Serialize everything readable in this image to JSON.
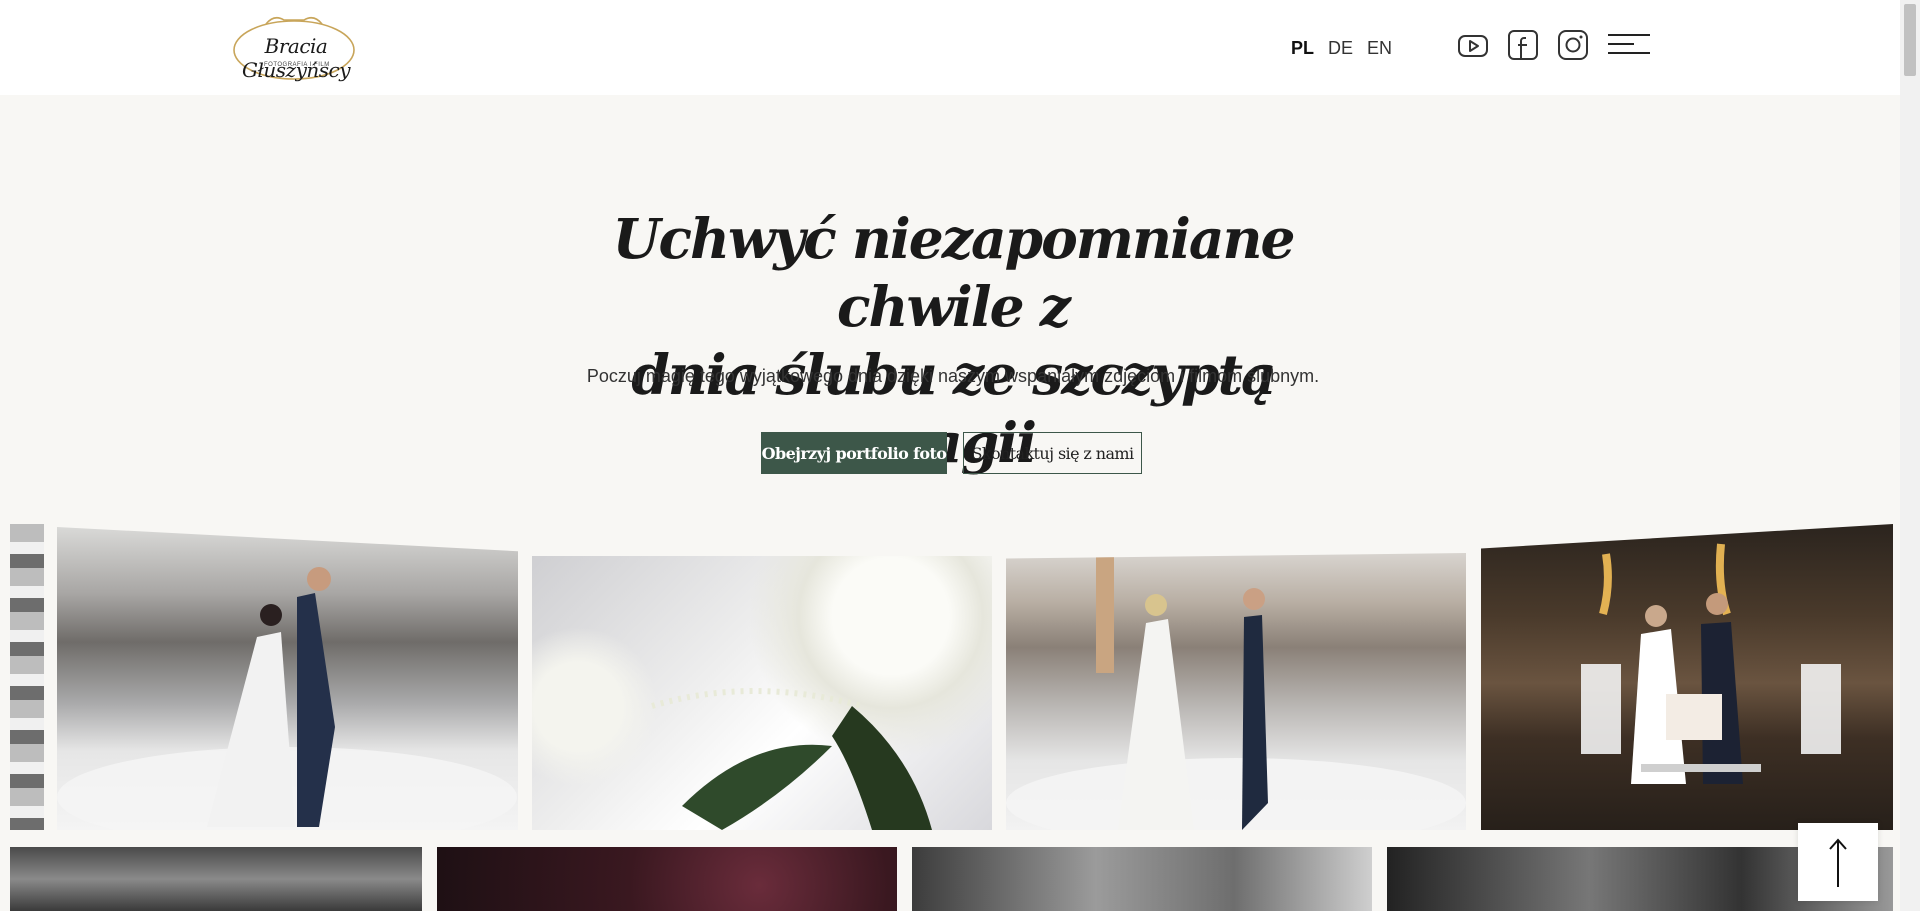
{
  "header": {
    "logo": {
      "title": "Bracia Głuszyńscy",
      "subtitle": "FOTOGRAFIA I FILM"
    },
    "languages": [
      {
        "code": "PL",
        "active": true
      },
      {
        "code": "DE",
        "active": false
      },
      {
        "code": "EN",
        "active": false
      }
    ],
    "social": [
      {
        "icon": "youtube-icon"
      },
      {
        "icon": "facebook-icon"
      },
      {
        "icon": "instagram-icon"
      }
    ],
    "menu_icon": "hamburger-menu-icon"
  },
  "hero": {
    "title_line1": "Uchwyć niezapomniane chwile z",
    "title_line2": "dnia ślubu ze szczyptą magii",
    "subtitle": "Poczuj magię tego wyjątkowego dnia dzięki naszym wspaniałym zdjęciom i filmom ślubnym.",
    "primary_button": "Obejrzyj portfolio foto",
    "secondary_button": "Skontaktuj się z nami"
  },
  "gallery": {
    "row1": [
      {
        "name": "photo-first-dance-smoke"
      },
      {
        "name": "photo-white-rose-boutonniere"
      },
      {
        "name": "photo-first-dance-hall"
      },
      {
        "name": "photo-cake-sparklers"
      }
    ],
    "row2": [
      {
        "name": "photo-bw-couple-trees"
      },
      {
        "name": "photo-party-lights"
      },
      {
        "name": "photo-bw-interior"
      },
      {
        "name": "photo-bw-outdoor"
      }
    ]
  },
  "scroll_to_top_icon": "arrow-up-icon",
  "colors": {
    "accent": "#3d5749",
    "background": "#f8f7f4",
    "header_bg": "#ffffff"
  }
}
